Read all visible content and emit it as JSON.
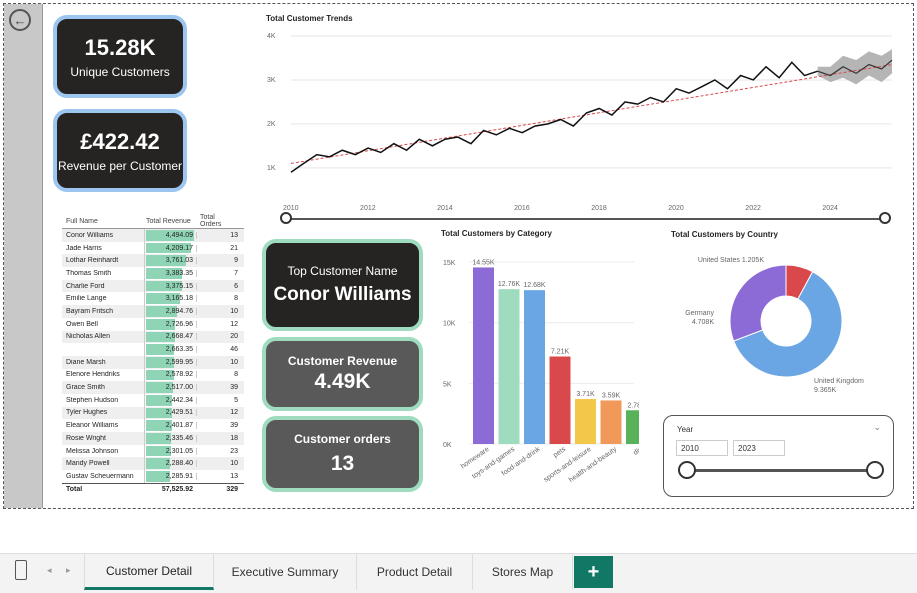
{
  "kpis": {
    "unique_customers": {
      "value": "15.28K",
      "label": "Unique Customers"
    },
    "revenue_per_customer": {
      "value": "£422.42",
      "label": "Revenue per Customer"
    },
    "top_customer": {
      "label": "Top Customer Name",
      "value": "Conor Williams"
    },
    "customer_revenue": {
      "label": "Customer Revenue",
      "value": "4.49K"
    },
    "customer_orders": {
      "label": "Customer orders",
      "value": "13"
    }
  },
  "table": {
    "headers": [
      "Full Name",
      "Total Revenue",
      "Total Orders"
    ],
    "rows": [
      {
        "name": "Conor Williams",
        "revenue": "4,494.09",
        "orders": "13",
        "rev_value": 4494.09
      },
      {
        "name": "Jade Harris",
        "revenue": "4,209.17",
        "orders": "21",
        "rev_value": 4209.17
      },
      {
        "name": "Lothar Reinhardt",
        "revenue": "3,761.03",
        "orders": "9",
        "rev_value": 3761.03
      },
      {
        "name": "Thomas Smith",
        "revenue": "3,383.35",
        "orders": "7",
        "rev_value": 3383.35
      },
      {
        "name": "Charlie Ford",
        "revenue": "3,375.15",
        "orders": "6",
        "rev_value": 3375.15
      },
      {
        "name": "Emilie Lange",
        "revenue": "3,165.18",
        "orders": "8",
        "rev_value": 3165.18
      },
      {
        "name": "Bayram Fritsch",
        "revenue": "2,894.76",
        "orders": "10",
        "rev_value": 2894.76
      },
      {
        "name": "Owen Bell",
        "revenue": "2,726.96",
        "orders": "12",
        "rev_value": 2726.96
      },
      {
        "name": "Nicholas Allen",
        "revenue": "2,668.47",
        "orders": "20",
        "rev_value": 2668.47
      },
      {
        "name": "",
        "revenue": "2,663.35",
        "orders": "46",
        "rev_value": 2663.35
      },
      {
        "name": "Diane Marsh",
        "revenue": "2,599.95",
        "orders": "10",
        "rev_value": 2599.95
      },
      {
        "name": "Elenore Hendriks",
        "revenue": "2,578.92",
        "orders": "8",
        "rev_value": 2578.92
      },
      {
        "name": "Grace Smith",
        "revenue": "2,517.00",
        "orders": "39",
        "rev_value": 2517.0
      },
      {
        "name": "Stephen Hudson",
        "revenue": "2,442.34",
        "orders": "5",
        "rev_value": 2442.34
      },
      {
        "name": "Tyler Hughes",
        "revenue": "2,429.51",
        "orders": "12",
        "rev_value": 2429.51
      },
      {
        "name": "Eleanor Williams",
        "revenue": "2,401.87",
        "orders": "39",
        "rev_value": 2401.87
      },
      {
        "name": "Rosie Wright",
        "revenue": "2,335.46",
        "orders": "18",
        "rev_value": 2335.46
      },
      {
        "name": "Melissa Johnson",
        "revenue": "2,301.05",
        "orders": "23",
        "rev_value": 2301.05
      },
      {
        "name": "Mandy Powell",
        "revenue": "2,288.40",
        "orders": "10",
        "rev_value": 2288.4
      },
      {
        "name": "Gustav Scheuermann",
        "revenue": "2,285.91",
        "orders": "13",
        "rev_value": 2285.91
      }
    ],
    "total": {
      "label": "Total",
      "revenue": "57,525.92",
      "orders": "329"
    }
  },
  "chart_data": [
    {
      "type": "line",
      "title": "Total Customer Trends",
      "y_ticks": [
        "1K",
        "2K",
        "3K",
        "4K"
      ],
      "x_ticks": [
        "2010",
        "2012",
        "2014",
        "2016",
        "2018",
        "2020",
        "2022",
        "2024"
      ],
      "ylim": [
        700,
        4000
      ],
      "xlim": [
        2010,
        2025.6
      ],
      "series": [
        {
          "x": [
            2010.0,
            2010.33,
            2010.67,
            2011.0,
            2011.33,
            2011.67,
            2012.0,
            2012.33,
            2012.67,
            2013.0,
            2013.33,
            2013.67,
            2014.0,
            2014.33,
            2014.67,
            2015.0,
            2015.33,
            2015.67,
            2016.0,
            2016.33,
            2016.67,
            2017.0,
            2017.33,
            2017.67,
            2018.0,
            2018.33,
            2018.67,
            2019.0,
            2019.33,
            2019.67,
            2020.0,
            2020.33,
            2020.67,
            2021.0,
            2021.33,
            2021.67,
            2022.0,
            2022.33,
            2022.67,
            2023.0,
            2023.33,
            2023.67
          ],
          "values": [
            900,
            1100,
            1300,
            1250,
            1400,
            1300,
            1450,
            1350,
            1550,
            1400,
            1650,
            1500,
            1650,
            1700,
            1550,
            1850,
            1750,
            1900,
            1800,
            1950,
            2000,
            2100,
            1950,
            2250,
            2350,
            2200,
            2500,
            2450,
            2600,
            2500,
            2800,
            2700,
            2850,
            3000,
            2800,
            3100,
            3000,
            3300,
            3050,
            3400,
            3100,
            3200
          ]
        }
      ],
      "forecast": {
        "x": [
          2023.67,
          2024.0,
          2024.33,
          2024.67,
          2025.0,
          2025.33,
          2025.6
        ],
        "values": [
          3200,
          3100,
          3300,
          3150,
          3350,
          3250,
          3450
        ],
        "upper": [
          3300,
          3300,
          3550,
          3450,
          3650,
          3550,
          3700
        ],
        "lower": [
          3100,
          2950,
          3050,
          2900,
          3100,
          2950,
          3150
        ]
      },
      "trend": {
        "x": [
          2010,
          2025.6
        ],
        "values": [
          1100,
          3350
        ]
      },
      "grid": true
    },
    {
      "type": "bar",
      "title": "Total Customers by Category",
      "categories": [
        "homeware",
        "toys-and-games",
        "food-and-drink",
        "pets",
        "sports-and-leisure",
        "health-and-beauty",
        "diy"
      ],
      "values": [
        14550,
        12760,
        12680,
        7210,
        3710,
        3590,
        2780
      ],
      "data_labels": [
        "14.55K",
        "12.76K",
        "12.68K",
        "7.21K",
        "3.71K",
        "3.59K",
        "2.78K"
      ],
      "colors": [
        "#8d6bd6",
        "#9fdcbf",
        "#6aa6e3",
        "#d9484a",
        "#f2c84b",
        "#f0995b",
        "#58b25a"
      ],
      "y_ticks": [
        "0K",
        "5K",
        "10K",
        "15K"
      ],
      "ylim": [
        0,
        15000
      ]
    },
    {
      "type": "pie",
      "title": "Total Customers by Country",
      "slices": [
        {
          "name": "United Kingdom",
          "value": 9365,
          "label": "United Kingdom\n9.365K",
          "color": "#6aa6e3"
        },
        {
          "name": "Germany",
          "value": 4708,
          "label": "Germany\n4.708K",
          "color": "#8d6bd6"
        },
        {
          "name": "United States",
          "value": 1205,
          "label": "United States 1.205K",
          "color": "#d9484a"
        }
      ]
    }
  ],
  "year_filter": {
    "title": "Year",
    "start": "2010",
    "end": "2023",
    "range": [
      2010,
      2023
    ]
  },
  "tabs": [
    "Customer Detail",
    "Executive Summary",
    "Product Detail",
    "Stores Map"
  ],
  "active_tab": "Customer Detail",
  "add_tab_symbol": "+",
  "icons": {
    "back": "back-arrow-icon",
    "phone": "phone-icon"
  }
}
